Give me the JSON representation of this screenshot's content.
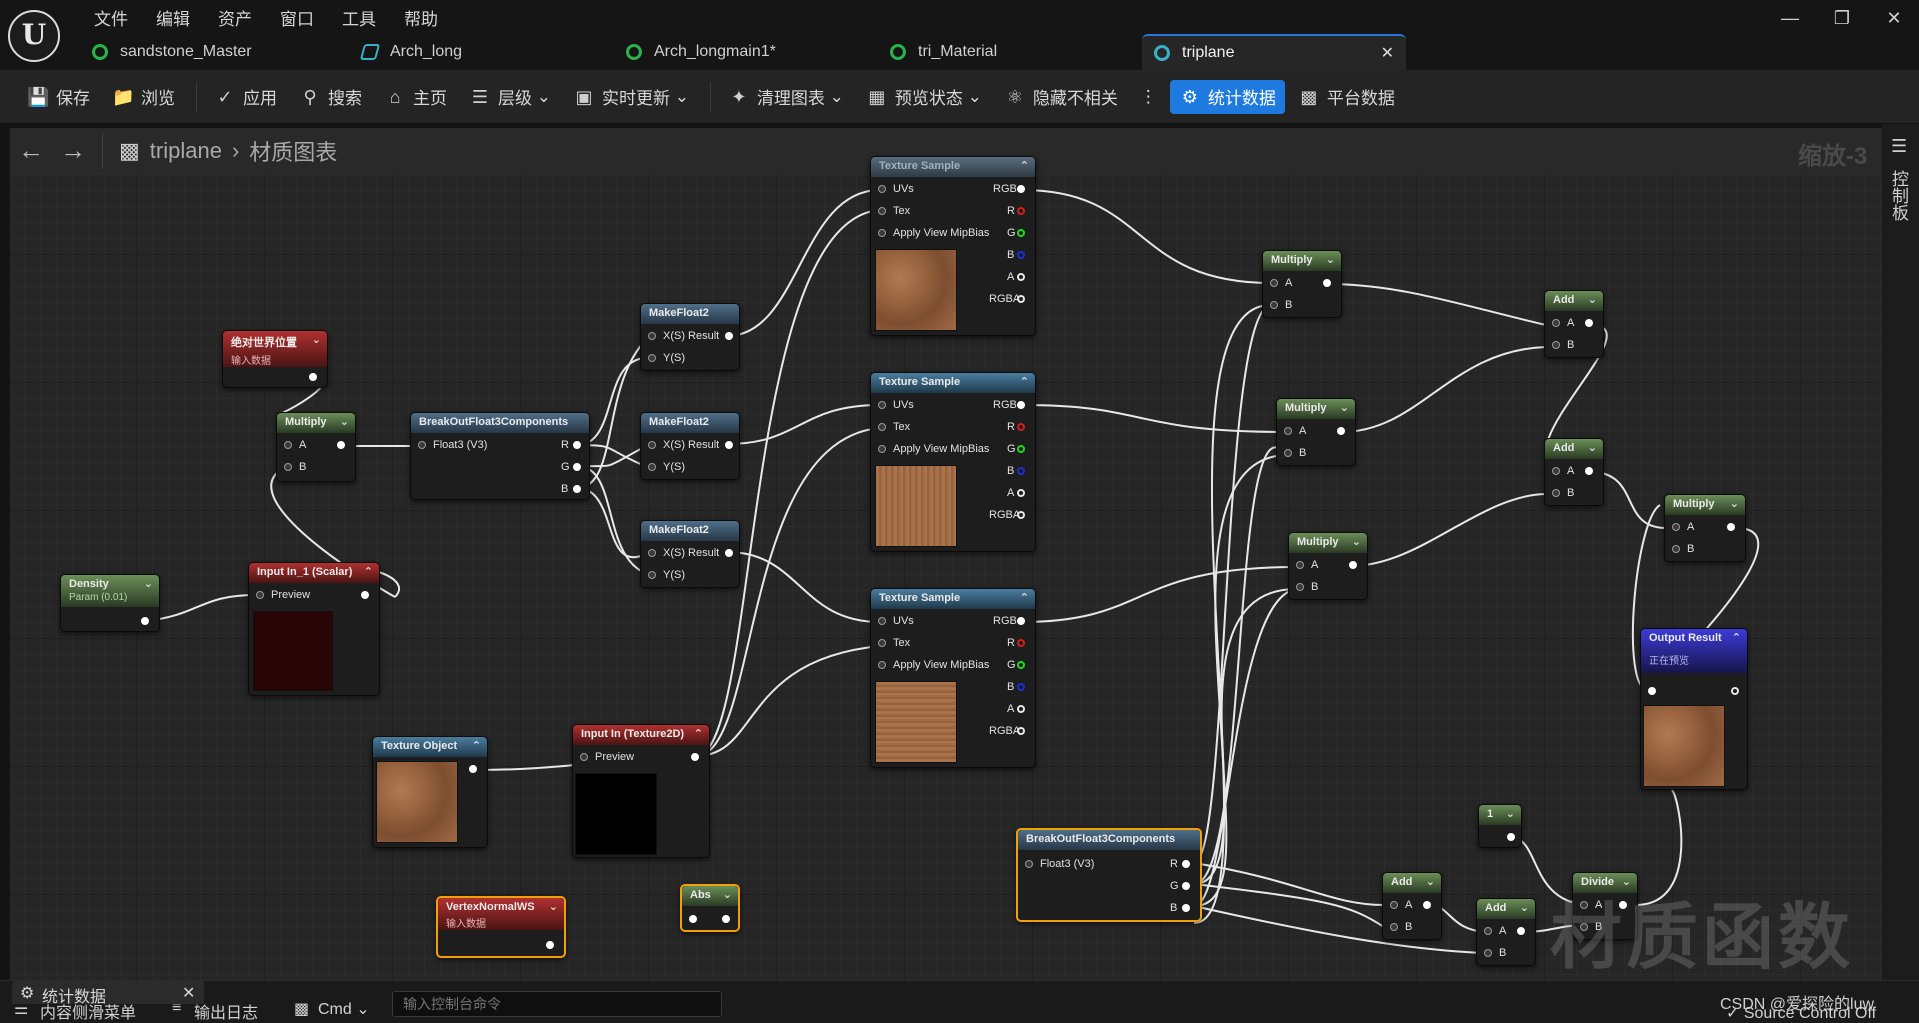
{
  "app": {
    "menu": [
      "文件",
      "编辑",
      "资产",
      "窗口",
      "工具",
      "帮助"
    ],
    "tabs": [
      {
        "label": "sandstone_Master",
        "icon": "material-instance-icon",
        "color": "#29b34a"
      },
      {
        "label": "Arch_long",
        "icon": "static-mesh-icon",
        "color": "#3ab0c8"
      },
      {
        "label": "Arch_longmain1*",
        "icon": "material-instance-icon",
        "color": "#29b34a"
      },
      {
        "label": "tri_Material",
        "icon": "material-instance-icon",
        "color": "#29b34a"
      },
      {
        "label": "triplane",
        "icon": "material-function-icon",
        "color": "#3ab0c8",
        "active": true
      }
    ]
  },
  "toolbar": {
    "save": "保存",
    "browse": "浏览",
    "apply": "应用",
    "search": "搜索",
    "home": "主页",
    "hierarchy": "层级",
    "live_update": "实时更新",
    "clean_graph": "清理图表",
    "preview_state": "预览状态",
    "hide_unrelated": "隐藏不相关",
    "stats": "统计数据",
    "platform_stats": "平台数据"
  },
  "graph": {
    "breadcrumb": [
      "triplane",
      "材质图表"
    ],
    "zoom": "缩放-3",
    "side_panel": "控制板",
    "watermark": "材质函数"
  },
  "nodes": {
    "worldpos": {
      "title": "绝对世界位置",
      "sub": "输入数据"
    },
    "multiply1": {
      "title": "Multiply",
      "a": "A",
      "b": "B"
    },
    "breakout1": {
      "title": "BreakOutFloat3Components",
      "in": "Float3 (V3)",
      "r": "R",
      "g": "G",
      "b": "B"
    },
    "makefloat_a": {
      "title": "MakeFloat2",
      "x": "X(S) Result",
      "y": "Y(S)"
    },
    "makefloat_b": {
      "title": "MakeFloat2",
      "x": "X(S) Result",
      "y": "Y(S)"
    },
    "makefloat_c": {
      "title": "MakeFloat2",
      "x": "X(S) Result",
      "y": "Y(S)"
    },
    "density": {
      "title": "Density",
      "sub": "Param (0.01)"
    },
    "input_scalar": {
      "title": "Input In_1 (Scalar)",
      "preview": "Preview"
    },
    "texobj": {
      "title": "Texture Object"
    },
    "input_tex": {
      "title": "Input In (Texture2D)",
      "preview": "Preview"
    },
    "vnorm": {
      "title": "VertexNormalWS",
      "sub": "输入数据"
    },
    "abs": {
      "title": "Abs"
    },
    "tex1": {
      "title": "Texture Sample",
      "uvs": "UVs",
      "tex": "Tex",
      "mip": "Apply View MipBias",
      "rgb": "RGB",
      "r": "R",
      "g": "G",
      "b": "B",
      "a": "A",
      "rgba": "RGBA"
    },
    "tex2": {
      "title": "Texture Sample",
      "uvs": "UVs",
      "tex": "Tex",
      "mip": "Apply View MipBias",
      "rgb": "RGB",
      "r": "R",
      "g": "G",
      "b": "B",
      "a": "A",
      "rgba": "RGBA"
    },
    "tex3": {
      "title": "Texture Sample",
      "uvs": "UVs",
      "tex": "Tex",
      "mip": "Apply View MipBias",
      "rgb": "RGB",
      "r": "R",
      "g": "G",
      "b": "B",
      "a": "A",
      "rgba": "RGBA"
    },
    "breakout2": {
      "title": "BreakOutFloat3Components",
      "in": "Float3 (V3)",
      "r": "R",
      "g": "G",
      "b": "B"
    },
    "mul2": {
      "title": "Multiply",
      "a": "A",
      "b": "B"
    },
    "mul3": {
      "title": "Multiply",
      "a": "A",
      "b": "B"
    },
    "mul4": {
      "title": "Multiply",
      "a": "A",
      "b": "B"
    },
    "add1": {
      "title": "Add",
      "a": "A",
      "b": "B"
    },
    "add2": {
      "title": "Add",
      "a": "A",
      "b": "B"
    },
    "mul5": {
      "title": "Multiply",
      "a": "A",
      "b": "B"
    },
    "output": {
      "title": "Output Result",
      "sub": "正在预览"
    },
    "const1": {
      "title": "1"
    },
    "add3": {
      "title": "Add",
      "a": "A",
      "b": "B"
    },
    "add4": {
      "title": "Add",
      "a": "A",
      "b": "B"
    },
    "divide": {
      "title": "Divide",
      "a": "A",
      "b": "B"
    }
  },
  "bottom": {
    "stats_tab": "统计数据",
    "content_drawer": "内容侧滑菜单",
    "output_log": "输出日志",
    "cmd": "Cmd",
    "console_placeholder": "输入控制台命令",
    "csdn": "CSDN @爱探险的luw",
    "source_control": "Source Control Off"
  }
}
